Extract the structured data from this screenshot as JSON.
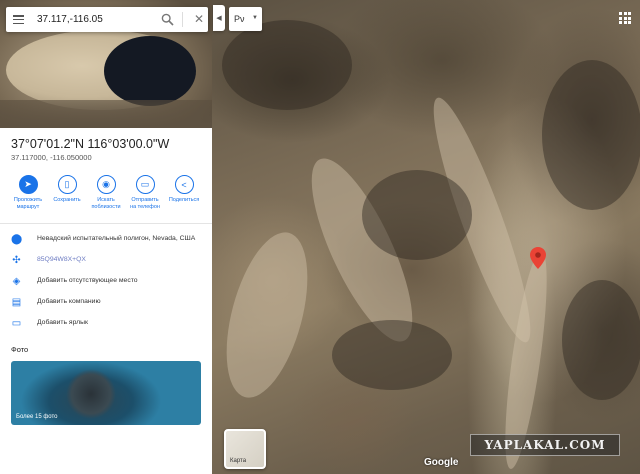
{
  "search": {
    "query": "37.117,-116.05"
  },
  "place": {
    "coordinates_dms": "37°07'01.2\"N 116°03'00.0\"W",
    "coordinates_decimal": "37.117000, -116.050000"
  },
  "actions": [
    {
      "icon": "directions-icon",
      "label_line1": "Проложить",
      "label_line2": "маршрут"
    },
    {
      "icon": "bookmark-icon",
      "label_line1": "Сохранить",
      "label_line2": ""
    },
    {
      "icon": "nearby-icon",
      "label_line1": "Искать",
      "label_line2": "поблизости"
    },
    {
      "icon": "send-to-phone-icon",
      "label_line1": "Отправить",
      "label_line2": "на телефон"
    },
    {
      "icon": "share-icon",
      "label_line1": "Поделиться",
      "label_line2": ""
    }
  ],
  "details": [
    {
      "icon": "location-pin-icon",
      "text": "Невадский испытательный полигон, Nevada, США"
    },
    {
      "icon": "plus-code-icon",
      "text": "85Q94W8X+QX"
    },
    {
      "icon": "add-place-icon",
      "text": "Добавить отсутствующее место"
    },
    {
      "icon": "business-icon",
      "text": "Добавить компанию"
    },
    {
      "icon": "label-icon",
      "text": "Добавить ярлык"
    }
  ],
  "photos": {
    "title": "Фото",
    "more_label": "Более 15 фото"
  },
  "map": {
    "layer_label": "Рν",
    "minimap_label": "Карта",
    "attribution": "Google",
    "watermark": "YAPLAKAL.COM",
    "pin_color": "#ea4335"
  },
  "colors": {
    "accent": "#1a73e8"
  }
}
